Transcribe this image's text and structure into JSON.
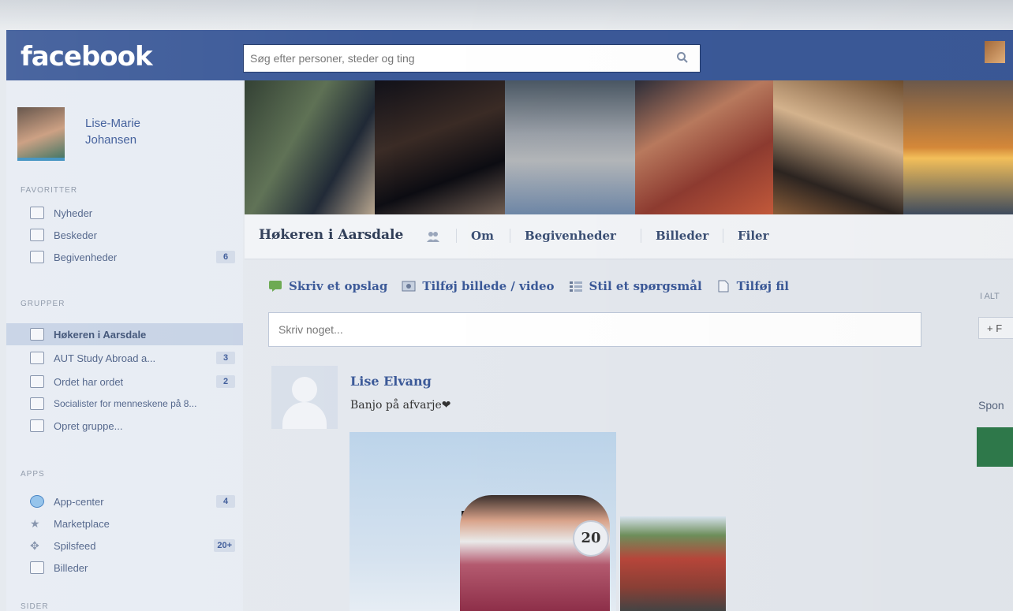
{
  "header": {
    "logo_text": "facebook",
    "search_placeholder": "Søg efter personer, steder og ting"
  },
  "sidebar": {
    "profile_name": "Lise-Marie Johansen",
    "favorites_heading": "FAVORITTER",
    "favorites": [
      {
        "label": "Nyheder",
        "icon": "news-icon"
      },
      {
        "label": "Beskeder",
        "icon": "messages-icon"
      },
      {
        "label": "Begivenheder",
        "icon": "events-icon",
        "count": "6"
      }
    ],
    "groups_heading": "GRUPPER",
    "groups": [
      {
        "label": "Høkeren i Aarsdale",
        "icon": "group-icon",
        "active": true
      },
      {
        "label": "AUT Study Abroad a...",
        "icon": "group-icon",
        "count": "3"
      },
      {
        "label": "Ordet har ordet",
        "icon": "group-icon",
        "count": "2"
      },
      {
        "label": "Socialister for menneskene på 8...",
        "icon": "group-icon"
      },
      {
        "label": "Opret gruppe...",
        "icon": "create-group-icon"
      }
    ],
    "apps_heading": "APPS",
    "apps": [
      {
        "label": "App-center",
        "icon": "app-center-icon",
        "count": "4"
      },
      {
        "label": "Marketplace",
        "icon": "marketplace-icon"
      },
      {
        "label": "Spilsfeed",
        "icon": "games-icon",
        "count": "20+"
      },
      {
        "label": "Billeder",
        "icon": "photos-icon"
      }
    ],
    "more_heading": "SIDER"
  },
  "group": {
    "title": "Høkeren i Aarsdale",
    "tabs": [
      "Om",
      "Begivenheder",
      "Billeder",
      "Filer"
    ]
  },
  "composer": {
    "actions": [
      {
        "label": "Skriv et opslag",
        "icon": "write-post-icon"
      },
      {
        "label": "Tilføj billede / video",
        "icon": "add-photo-icon"
      },
      {
        "label": "Stil et spørgsmål",
        "icon": "ask-question-icon"
      },
      {
        "label": "Tilføj fil",
        "icon": "add-file-icon"
      }
    ],
    "placeholder": "Skriv noget..."
  },
  "post": {
    "author": "Lise Elvang",
    "text": "Banjo på afvarje❤",
    "photo_badge": "20"
  },
  "right_column": {
    "label": "I ALT",
    "button": "+ F",
    "sponsored": "Spon"
  },
  "colors": {
    "brand": "#3b5998",
    "sidebar_bg": "#e7ecf3",
    "active_item_bg": "#c6d2e5"
  }
}
